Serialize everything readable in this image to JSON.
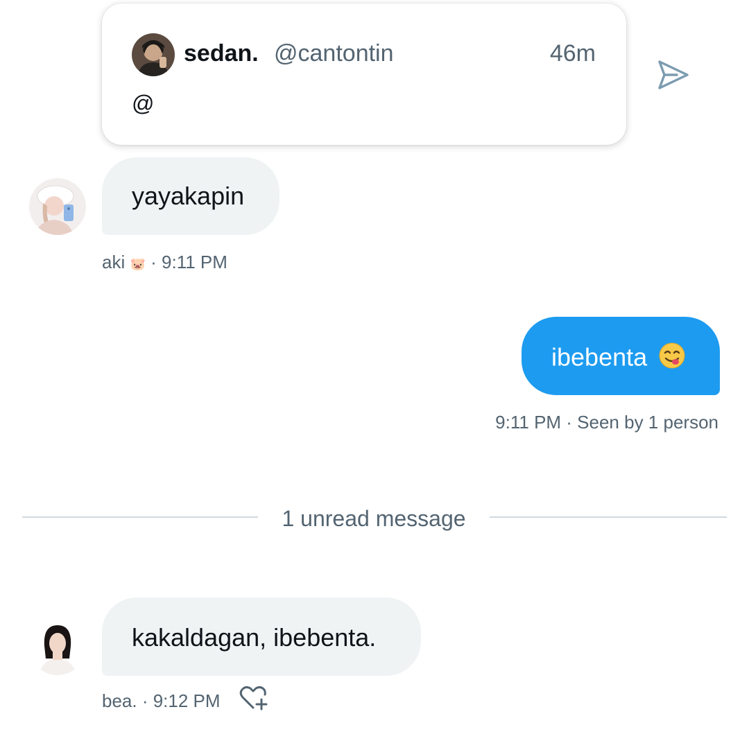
{
  "quoted_tweet": {
    "display_name": "sedan.",
    "handle": "@cantontin",
    "time": "46m",
    "text": "@",
    "avatar_icon": "user-avatar-photo"
  },
  "share_icon": "send-icon",
  "messages": [
    {
      "direction": "incoming",
      "text": "yayakapin",
      "sender": "aki",
      "sender_badge": "🐷",
      "time": "9:11 PM",
      "meta": "· 9:11 PM"
    },
    {
      "direction": "outgoing",
      "text": "ibebenta",
      "emoji": "😋",
      "meta": "9:11 PM · Seen by 1 person"
    },
    {
      "direction": "incoming",
      "text": "kakaldagan, ibebenta.",
      "sender": "bea.",
      "time": "9:12 PM",
      "meta": "bea. · 9:12 PM",
      "react_icon": "add-reaction-heart-icon"
    }
  ],
  "divider": {
    "label": "1 unread message"
  },
  "colors": {
    "outgoing_bubble": "#1d9bf0",
    "incoming_bubble": "#eff3f4",
    "secondary_text": "#536471",
    "primary_text": "#0f1419",
    "divider": "#cfd9de"
  }
}
